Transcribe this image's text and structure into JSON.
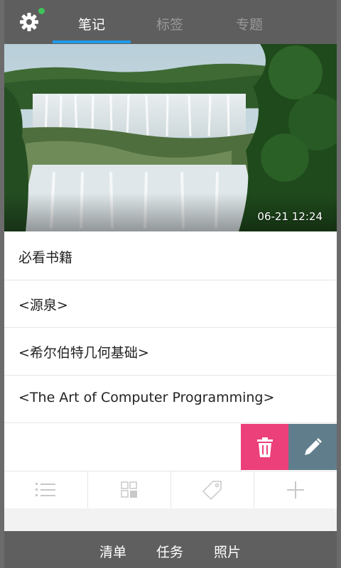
{
  "topbar": {
    "tabs": [
      {
        "label": "笔记",
        "active": true
      },
      {
        "label": "标签",
        "active": false
      },
      {
        "label": "专题",
        "active": false
      }
    ],
    "settings_icon": "gear-icon",
    "status_dot_color": "#3fc25a",
    "active_tab_color": "#1e9bea"
  },
  "hero": {
    "timestamp": "06-21 12:24"
  },
  "notes": [
    {
      "title": "必看书籍"
    },
    {
      "title": "<源泉>"
    },
    {
      "title": "<希尔伯特几何基础>"
    },
    {
      "title": "<The Art of Computer Programming>"
    }
  ],
  "actions": {
    "delete_icon": "trash-icon",
    "edit_icon": "pencil-icon",
    "delete_color": "#ec407a",
    "edit_color": "#607d8b"
  },
  "toolbar": {
    "icons": [
      "list-icon",
      "grid-icon",
      "tag-icon",
      "plus-icon"
    ]
  },
  "bottombar": {
    "items": [
      "清单",
      "任务",
      "照片"
    ]
  }
}
